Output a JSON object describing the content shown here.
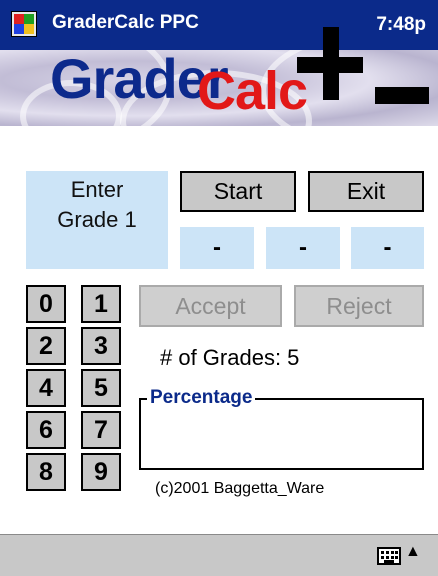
{
  "titlebar": {
    "app_title": "GraderCalc PPC",
    "clock": "7:48p",
    "icon": "windows-flag-icon"
  },
  "banner": {
    "logo_part1": "Grader",
    "logo_part2": "Calc",
    "plus_icon": "plus-icon",
    "minus_icon": "minus-icon"
  },
  "prompt": {
    "line1": "Enter",
    "line2": "Grade 1"
  },
  "buttons": {
    "start": "Start",
    "exit": "Exit",
    "accept": "Accept",
    "reject": "Reject"
  },
  "slots": [
    "-",
    "-",
    "-"
  ],
  "digits": [
    "0",
    "1",
    "2",
    "3",
    "4",
    "5",
    "6",
    "7",
    "8",
    "9"
  ],
  "count_text": "# of Grades: 5",
  "percentage_label": "Percentage",
  "percentage_value": "",
  "credit": "(c)2001 Baggetta_Ware",
  "menubar": {
    "keyboard_icon": "keyboard-icon",
    "arrow": "▲"
  },
  "colors": {
    "titlebar": "#0b2a8a",
    "panel": "#cce4f7",
    "button": "#c8c8c8",
    "logo_blue": "#0d2a8c",
    "logo_red": "#e21818"
  }
}
